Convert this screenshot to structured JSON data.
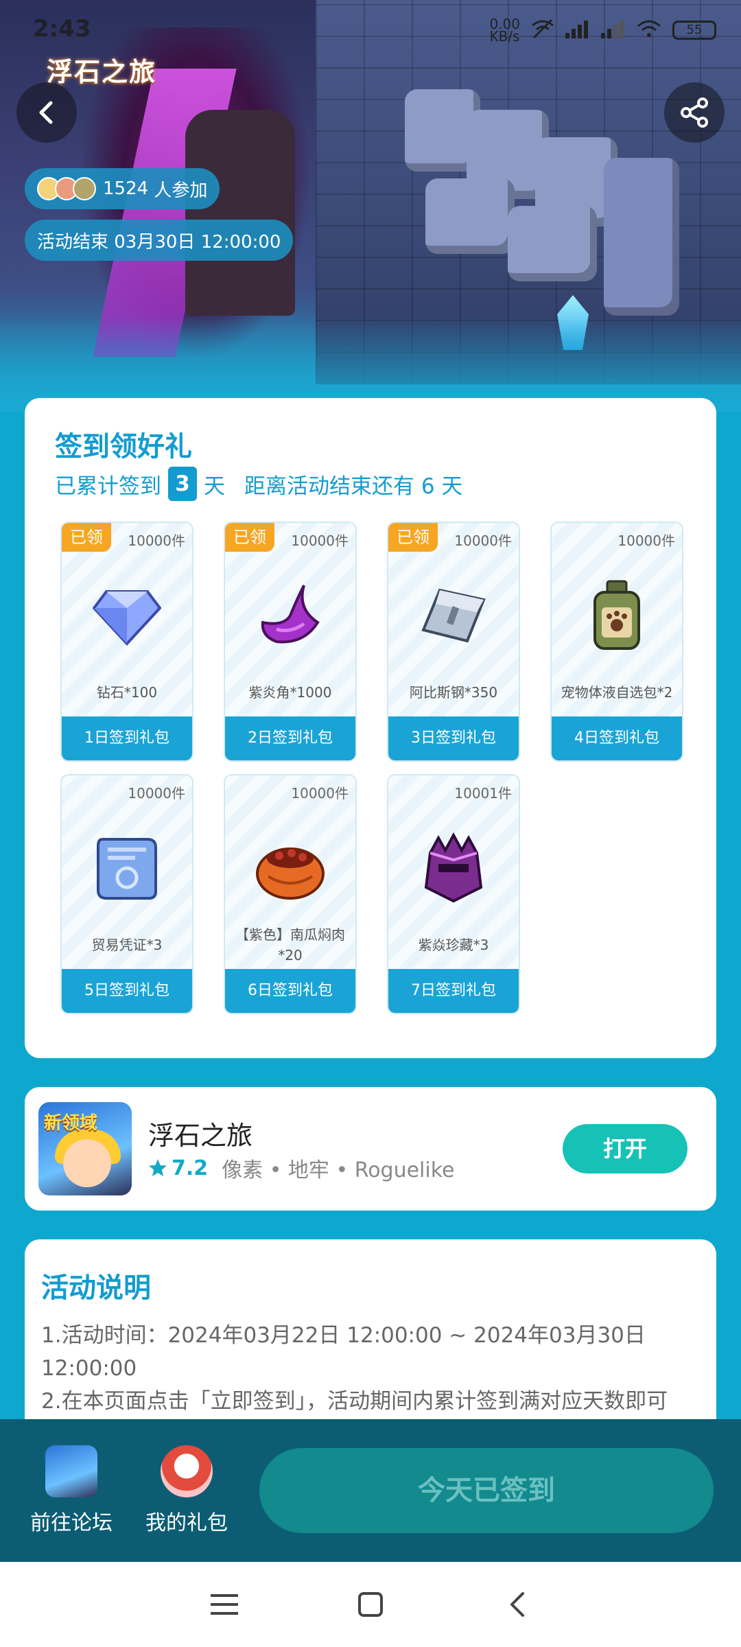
{
  "status_bar": {
    "time": "2:43",
    "net_speed": "0.00\nKB/s",
    "battery": "55"
  },
  "hero": {
    "logo_text": "浮石之旅",
    "participants_count": "1524",
    "participants_suffix": " 人参加",
    "end_label": "活动结束 03月30日 12:00:00"
  },
  "checkin": {
    "title": "签到领好礼",
    "cumulative_prefix": "已累计签到",
    "cumulative_days": "3",
    "cumulative_suffix": "天",
    "remaining_text": "距离活动结束还有 6 天",
    "rewards": [
      {
        "claimed": "已领",
        "qty": "10000件",
        "name": "钻石*100",
        "day": "1日签到礼包",
        "icon": "diamond-icon"
      },
      {
        "claimed": "已领",
        "qty": "10000件",
        "name": "紫炎角*1000",
        "day": "2日签到礼包",
        "icon": "purple-horn-icon"
      },
      {
        "claimed": "已领",
        "qty": "10000件",
        "name": "阿比斯钢*350",
        "day": "3日签到礼包",
        "icon": "steel-ingot-icon"
      },
      {
        "claimed": "",
        "qty": "10000件",
        "name": "宠物体液自选包*2",
        "day": "4日签到礼包",
        "icon": "pet-potion-icon"
      },
      {
        "claimed": "",
        "qty": "10000件",
        "name": "贸易凭证*3",
        "day": "5日签到礼包",
        "icon": "trade-scroll-icon"
      },
      {
        "claimed": "",
        "qty": "10000件",
        "name": "【紫色】南瓜焖肉*20",
        "day": "6日签到礼包",
        "icon": "pumpkin-dish-icon"
      },
      {
        "claimed": "",
        "qty": "10001件",
        "name": "紫焱珍藏*3",
        "day": "7日签到礼包",
        "icon": "purple-helmet-icon"
      }
    ]
  },
  "game": {
    "icon_text": "新领域",
    "name": "浮石之旅",
    "rating": "7.2",
    "tags": "像素 • 地牢 • Roguelike",
    "open_label": "打开"
  },
  "rules": {
    "title": "活动说明",
    "line1": "1.活动时间：2024年03月22日 12:00:00 ~ 2024年03月30日 12:00:00",
    "line2": "2.在本页面点击「立即签到」，活动期间内累计签到满对应天数即可"
  },
  "actions": {
    "forum_label": "前往论坛",
    "gifts_label": "我的礼包",
    "signed_label": "今天已签到"
  },
  "colors": {
    "accent": "#139ccf",
    "background": "#0ea8cf",
    "claimed_badge": "#f6a623",
    "open_button": "#16c2b6",
    "action_bar": "#0c5d74"
  }
}
